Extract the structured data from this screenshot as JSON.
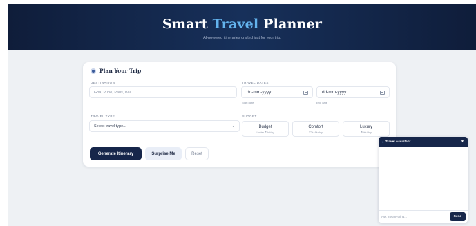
{
  "header": {
    "title_part1": "Smart ",
    "title_accent": "Travel",
    "title_part2": " Planner",
    "subtitle": "AI-powered itineraries crafted just for your trip."
  },
  "form": {
    "title": "Plan Your Trip",
    "destination": {
      "label": "DESTINATION",
      "placeholder": "Goa, Pune, Paris, Bali..."
    },
    "travel_dates": {
      "label": "TRAVEL DATES",
      "start_value": "dd-mm-yyyy",
      "start_hint": "Start date",
      "end_value": "dd-mm-yyyy",
      "end_hint": "End date"
    },
    "travel_type": {
      "label": "TRAVEL TYPE",
      "selected": "Select travel type..."
    },
    "budget": {
      "label": "BUDGET",
      "options": [
        {
          "name": "Budget",
          "desc": "Under ₹2k/day"
        },
        {
          "name": "Comfort",
          "desc": "₹2k–6k/day"
        },
        {
          "name": "Luxury",
          "desc": "₹6k+/day"
        }
      ]
    },
    "buttons": {
      "generate": "Generate Itinerary",
      "surprise": "Surprise Me",
      "reset": "Reset"
    }
  },
  "chat": {
    "title": "Travel Assistant",
    "toggle": "▼",
    "input_placeholder": "Ask me anything...",
    "send_label": "Send"
  }
}
